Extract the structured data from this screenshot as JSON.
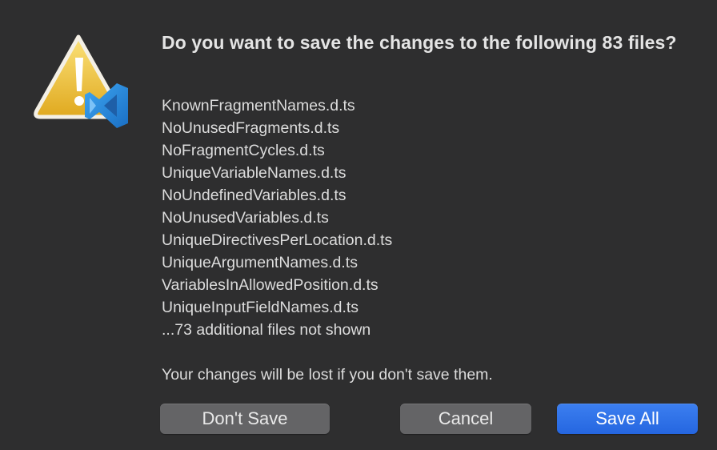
{
  "dialog": {
    "title": "Do you want to save the changes to the following 83 files?",
    "files": [
      "KnownFragmentNames.d.ts",
      "NoUnusedFragments.d.ts",
      "NoFragmentCycles.d.ts",
      "UniqueVariableNames.d.ts",
      "NoUndefinedVariables.d.ts",
      "NoUnusedVariables.d.ts",
      "UniqueDirectivesPerLocation.d.ts",
      "UniqueArgumentNames.d.ts",
      "VariablesInAllowedPosition.d.ts",
      "UniqueInputFieldNames.d.ts"
    ],
    "more_files": "...73 additional files not shown",
    "warning": "Your changes will be lost if you don't save them."
  },
  "buttons": {
    "dont_save": "Don't Save",
    "cancel": "Cancel",
    "save_all": "Save All"
  },
  "icons": {
    "app_icon": "vscode-warning-icon",
    "warning_color": "#f2c53c",
    "vscode_color": "#2f8fe0"
  },
  "colors": {
    "background": "#2e2e2f",
    "button": "#646466",
    "primary_button": "#2a6ee8"
  }
}
